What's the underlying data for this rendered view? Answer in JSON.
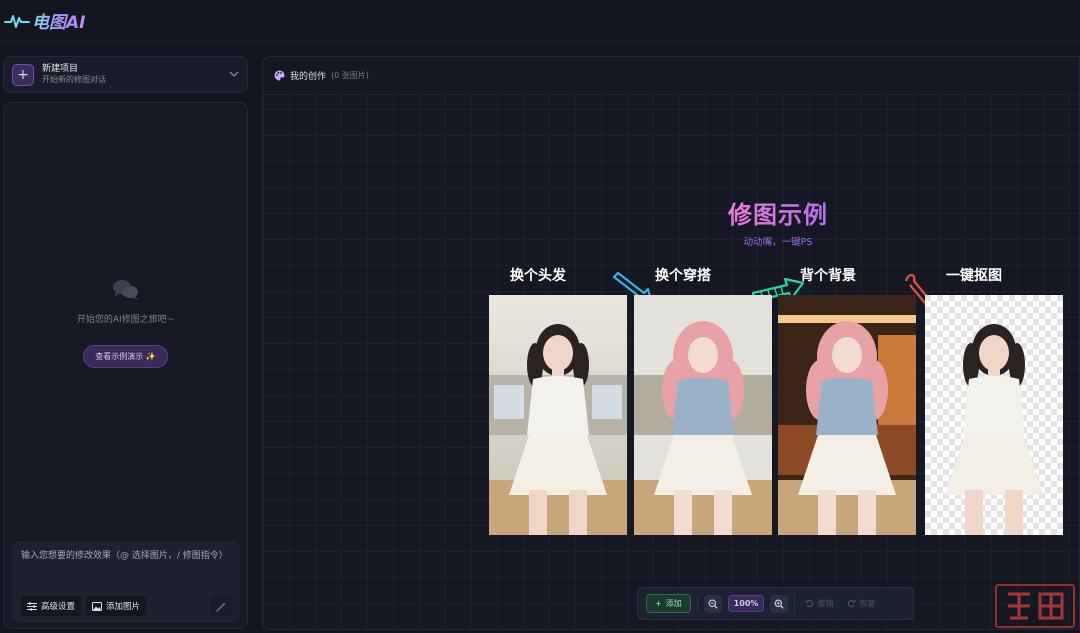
{
  "app": {
    "logo_text": "电图AI"
  },
  "sidebar": {
    "new_project": {
      "title": "新建项目",
      "subtitle": "开始新的修图对话"
    },
    "empty_state": {
      "text": "开始您的AI修图之旅吧~",
      "demo_button": "查看示例演示 ✨"
    },
    "input": {
      "placeholder": "输入您想要的修改效果（@ 选择图片，/ 修图指令）",
      "advanced_label": "高级设置",
      "add_image_label": "添加图片"
    }
  },
  "main": {
    "title": "我的创作",
    "count": "(0 张图片)",
    "example": {
      "title": "修图示例",
      "subtitle": "动动嘴，一键PS",
      "steps": [
        "换个头发",
        "换个穿搭",
        "背个背景",
        "一键抠图"
      ]
    }
  },
  "toolbar": {
    "add_label": "添加",
    "zoom": "100%",
    "undo_label": "撤销",
    "redo_label": "恢复"
  },
  "colors": {
    "accent_purple": "#8b5cf6",
    "add_green": "#8ee3b5",
    "highlight_yellow": "#f1c232"
  }
}
